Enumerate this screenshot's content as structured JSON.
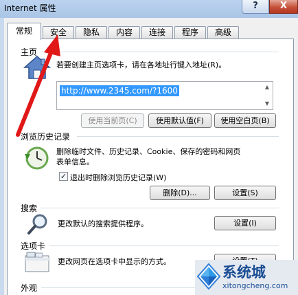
{
  "window": {
    "title": "Internet 属性",
    "help_label": "?",
    "close_label": "X"
  },
  "tabs": [
    {
      "label": "常规",
      "active": true
    },
    {
      "label": "安全",
      "active": false
    },
    {
      "label": "隐私",
      "active": false
    },
    {
      "label": "内容",
      "active": false
    },
    {
      "label": "连接",
      "active": false
    },
    {
      "label": "程序",
      "active": false
    },
    {
      "label": "高级",
      "active": false
    }
  ],
  "home": {
    "title": "主页",
    "description": "若要创建主页选项卡，请在各地址行键入地址(R)。",
    "url": "http://www.2345.com/?1600",
    "buttons": {
      "use_current": "使用当前页(C)",
      "use_default": "使用默认值(F)",
      "use_blank": "使用空白页(B)"
    }
  },
  "history": {
    "title": "浏览历史记录",
    "description_line1": "删除临时文件、历史记录、Cookie、保存的密码和网页",
    "description_line2": "表单信息。",
    "checkbox_label": "退出时删除浏览历史记录(W)",
    "checkbox_checked": true,
    "checkmark": "✓",
    "buttons": {
      "delete": "删除(D)...",
      "settings": "设置(S)"
    }
  },
  "search": {
    "title": "搜索",
    "description": "更改默认的搜索提供程序。",
    "settings_button": "设置(I)"
  },
  "tabs_section": {
    "title": "选项卡",
    "description": "更改网页在选项卡中显示的方式。",
    "settings_button": "设置(T)"
  },
  "appearance": {
    "title": "外观"
  },
  "watermark": {
    "name": "系统城",
    "domain": "xitongcheng.com"
  },
  "colors": {
    "selection": "#3399ff",
    "annotation_arrow": "#e01818",
    "watermark_blue": "#1a4d94"
  },
  "icons": {
    "home": "house-icon",
    "history": "history-clock-icon",
    "search": "magnifier-icon",
    "tabs": "tabs-window-icon",
    "watermark": "windows-logo-icon",
    "annotation": "red-arrow-icon"
  }
}
